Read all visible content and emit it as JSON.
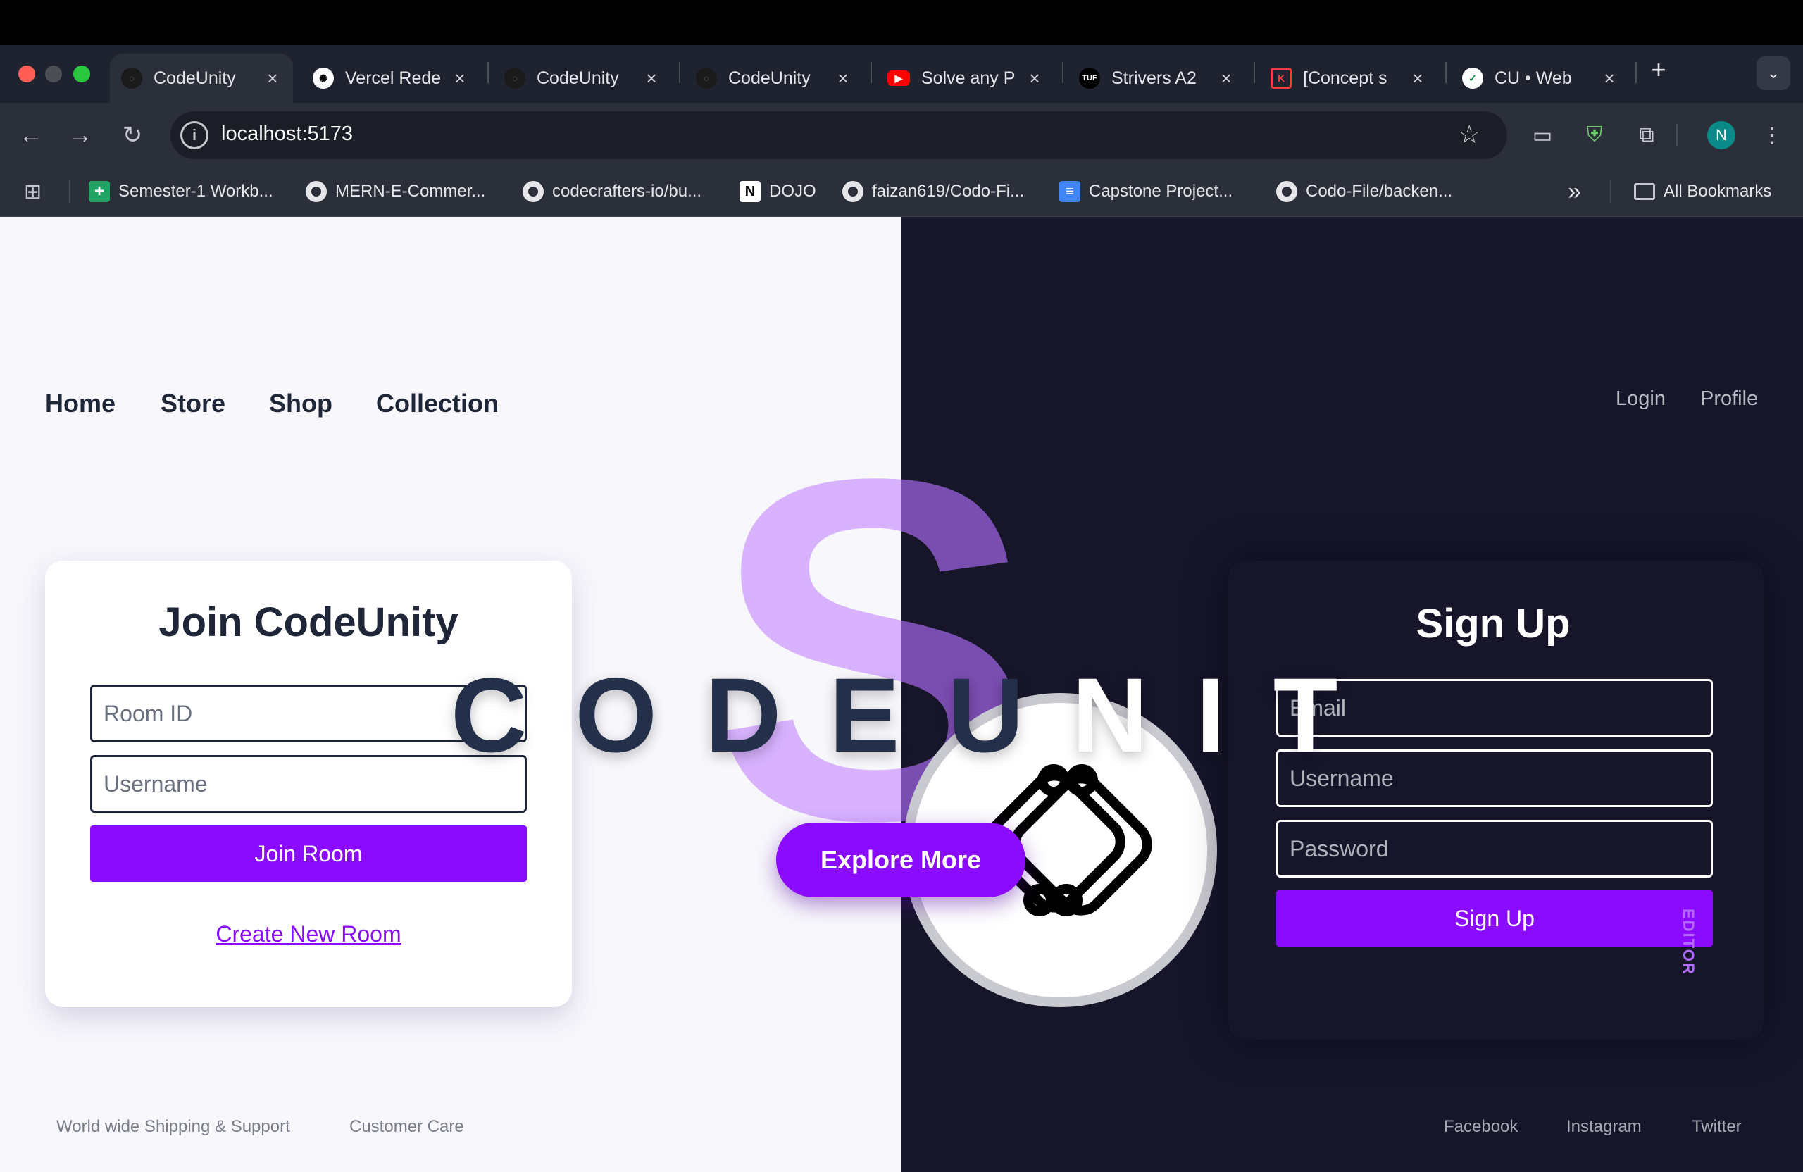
{
  "browser": {
    "tabs": [
      {
        "title": "CodeUnity",
        "favicon": "codeunity-icon",
        "active": true
      },
      {
        "title": "Vercel Rede",
        "favicon": "openai-icon",
        "active": false
      },
      {
        "title": "CodeUnity",
        "favicon": "codeunity-icon",
        "active": false
      },
      {
        "title": "CodeUnity",
        "favicon": "codeunity-icon",
        "active": false
      },
      {
        "title": "Solve any P",
        "favicon": "youtube-icon",
        "active": false
      },
      {
        "title": "Strivers A2",
        "favicon": "tuf-icon",
        "active": false
      },
      {
        "title": "[Concept s",
        "favicon": "concept-icon",
        "active": false
      },
      {
        "title": "CU • Web",
        "favicon": "cu-icon",
        "active": false
      }
    ],
    "tab_close": "×",
    "new_tab": "+",
    "tab_menu": "⌄",
    "address": "localhost:5173",
    "profile_initial": "N",
    "bookmarks": [
      {
        "label": "Semester-1 Workb...",
        "icon": "sheets-icon"
      },
      {
        "label": "MERN-E-Commer...",
        "icon": "github-icon"
      },
      {
        "label": "codecrafters-io/bu...",
        "icon": "github-icon"
      },
      {
        "label": "DOJO",
        "icon": "notion-icon"
      },
      {
        "label": "faizan619/Codo-Fi...",
        "icon": "github-icon"
      },
      {
        "label": "Capstone Project...",
        "icon": "docs-icon"
      },
      {
        "label": "Codo-File/backen...",
        "icon": "github-icon"
      }
    ],
    "bookmarks_overflow": "»",
    "all_bookmarks": "All Bookmarks"
  },
  "nav": {
    "left": [
      "Home",
      "Store",
      "Shop",
      "Collection"
    ],
    "right": [
      "Login",
      "Profile"
    ]
  },
  "hero": {
    "big_letter": "S",
    "brand": "CODEUNIT",
    "editor_tag": "EDITOR",
    "explore": "Explore More"
  },
  "join": {
    "title": "Join CodeUnity",
    "room_placeholder": "Room ID",
    "username_placeholder": "Username",
    "join_button": "Join Room",
    "create_link": "Create New Room"
  },
  "signup": {
    "title": "Sign Up",
    "email_placeholder": "Email",
    "username_placeholder": "Username",
    "password_placeholder": "Password",
    "button": "Sign Up"
  },
  "footer": {
    "left": [
      "World wide Shipping & Support",
      "Customer Care"
    ],
    "right": [
      "Facebook",
      "Instagram",
      "Twitter"
    ]
  },
  "colors": {
    "accent": "#8b0bff",
    "light_bg": "#f8f7fc",
    "dark_bg": "#16152a",
    "lavender": "#d8b2ff",
    "text_dark": "#1e2638"
  }
}
